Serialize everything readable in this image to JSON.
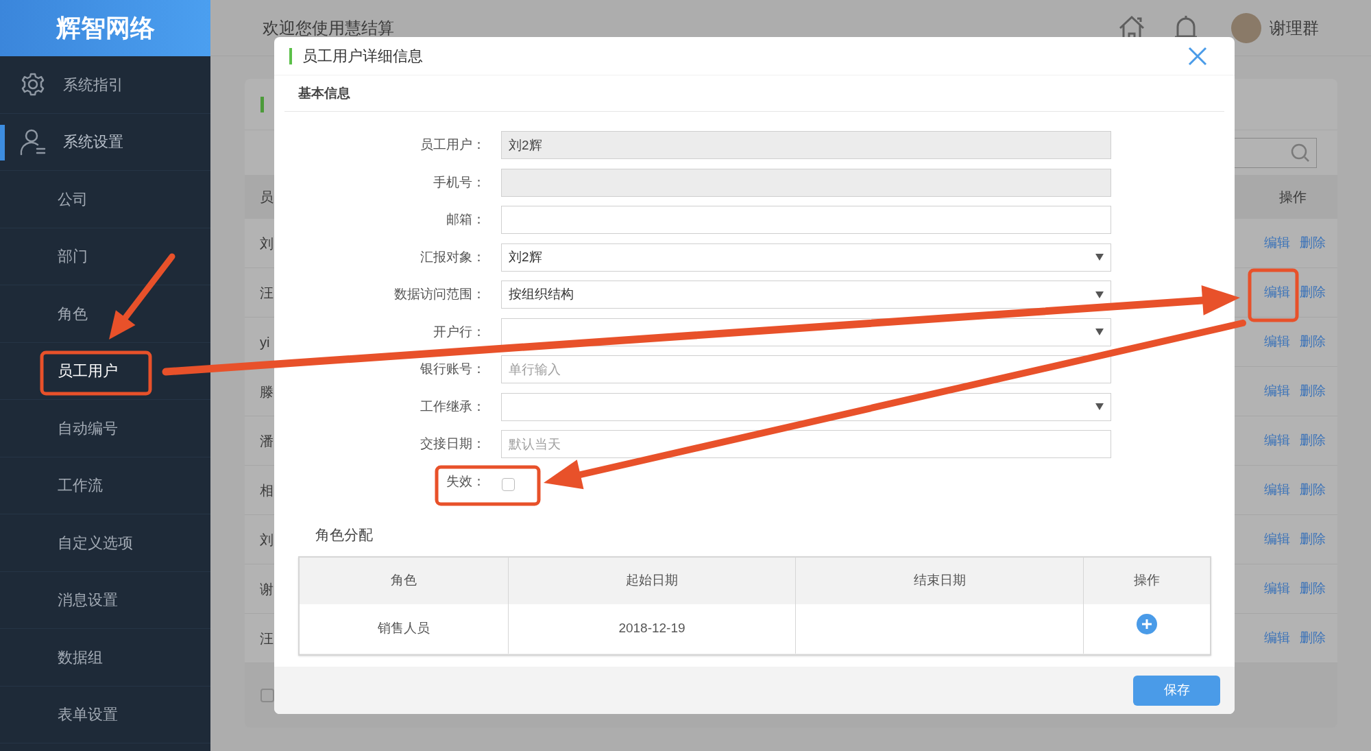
{
  "sidebar": {
    "logo": "辉智网络",
    "items": [
      {
        "label": "系统指引",
        "selected": false
      },
      {
        "label": "系统设置",
        "selected": true,
        "children": [
          {
            "label": "公司",
            "selected": false
          },
          {
            "label": "部门",
            "selected": false
          },
          {
            "label": "角色",
            "selected": false
          },
          {
            "label": "员工用户",
            "selected": true
          },
          {
            "label": "自动编号",
            "selected": false
          },
          {
            "label": "工作流",
            "selected": false
          },
          {
            "label": "自定义选项",
            "selected": false
          },
          {
            "label": "消息设置",
            "selected": false
          },
          {
            "label": "数据组",
            "selected": false
          },
          {
            "label": "表单设置",
            "selected": false
          }
        ]
      }
    ]
  },
  "header": {
    "title": "欢迎您使用慧结算",
    "user": "谢理群"
  },
  "background_list": {
    "columns": [
      "员",
      "操作"
    ],
    "rows": [
      {
        "column_1": "刘",
        "actions": [
          "编辑",
          "删除"
        ]
      },
      {
        "column_1": "汪",
        "actions": [
          "编辑",
          "删除"
        ]
      },
      {
        "column_1": "yi",
        "actions": [
          "编辑",
          "删除"
        ]
      },
      {
        "column_1": "滕",
        "actions": [
          "编辑",
          "删除"
        ]
      },
      {
        "column_1": "潘",
        "actions": [
          "编辑",
          "删除"
        ]
      },
      {
        "column_1": "相",
        "actions": [
          "编辑",
          "删除"
        ]
      },
      {
        "column_1": "刘",
        "actions": [
          "编辑",
          "删除"
        ]
      },
      {
        "column_1": "谢",
        "actions": [
          "编辑",
          "删除"
        ]
      },
      {
        "column_1": "汪",
        "actions": [
          "编辑",
          "删除"
        ]
      }
    ],
    "select_all": {
      "checked": false
    }
  },
  "modal": {
    "title": "员工用户详细信息",
    "section": "基本信息",
    "fields": [
      {
        "label": "员工用户：",
        "kind": "text",
        "value": "刘2辉",
        "disabled": true
      },
      {
        "label": "手机号：",
        "kind": "text",
        "disabled": true
      },
      {
        "label": "邮箱：",
        "kind": "text",
        "disabled": false
      },
      {
        "label": "汇报对象：",
        "kind": "select",
        "value": "刘2辉",
        "disabled": false
      },
      {
        "label": "数据访问范围：",
        "kind": "select",
        "value": "按组织结构",
        "disabled": false
      },
      {
        "label": "开户行：",
        "kind": "select",
        "disabled": false
      },
      {
        "label": "银行账号：",
        "kind": "text",
        "placeholder": "单行输入",
        "disabled": false
      },
      {
        "label": "工作继承：",
        "kind": "select",
        "disabled": false
      },
      {
        "label": "交接日期：",
        "kind": "text",
        "placeholder": "默认当天",
        "disabled": false
      },
      {
        "label": "失效：",
        "kind": "checkbox",
        "checked": false,
        "disabled": false
      }
    ],
    "roles": {
      "title": "角色分配",
      "columns": [
        "角色",
        "起始日期",
        "结束日期",
        "操作"
      ],
      "rows": [
        {
          "role": "销售人员",
          "start_date": "2018-12-19"
        }
      ]
    },
    "save": "保存"
  }
}
